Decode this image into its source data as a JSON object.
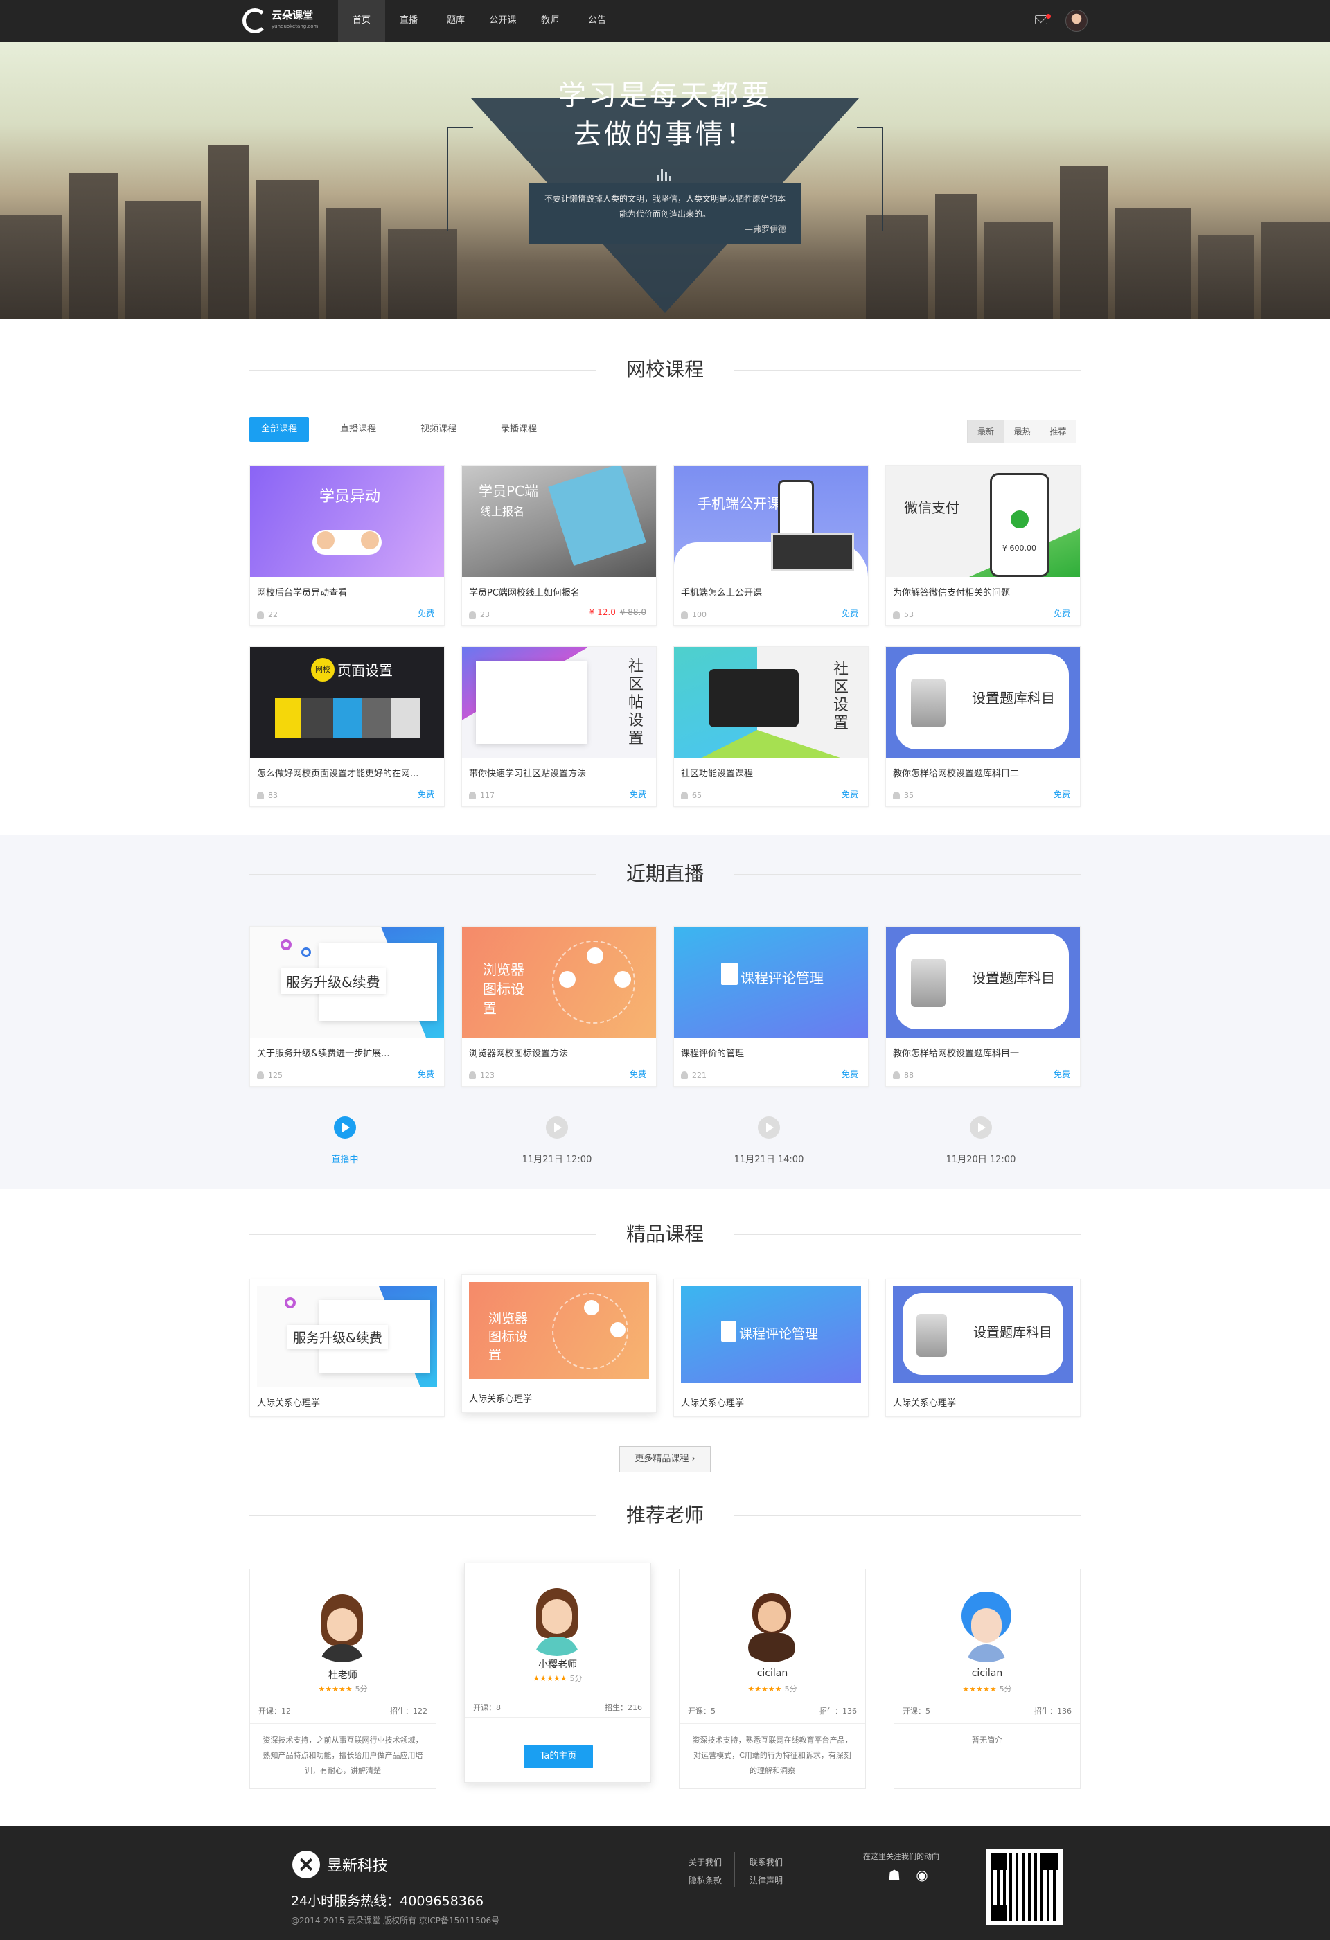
{
  "header": {
    "logo_text": "云朵课堂",
    "logo_sub": "yunduoketang.com",
    "nav": [
      "首页",
      "直播",
      "题库",
      "公开课",
      "教师",
      "公告"
    ]
  },
  "banner": {
    "title_line1": "学习是每天都要",
    "title_line2": "去做的事情！",
    "quote": "不要让懒惰毁掉人类的文明，我坚信，人类文明是以牺牲原始的本能为代价而创造出来的。",
    "author": "—弗罗伊德"
  },
  "online": {
    "title": "网校课程",
    "tabs": [
      "全部课程",
      "直播课程",
      "视频课程",
      "录播课程"
    ],
    "sort": [
      "最新",
      "最热",
      "推荐"
    ],
    "courses": [
      {
        "image_text": "学员异动",
        "title": "网校后台学员异动查看",
        "count": "22",
        "price": "免费"
      },
      {
        "image_text": "学员PC端线上报名",
        "title": "学员PC端网校线上如何报名",
        "count": "23",
        "price": "¥ 12.0",
        "old_price": "¥ 88.0"
      },
      {
        "image_text": "手机端公开课",
        "title": "手机端怎么上公开课",
        "count": "100",
        "price": "免费"
      },
      {
        "image_text": "微信支付",
        "title": "为你解答微信支付相关的问题",
        "count": "53",
        "price": "免费",
        "pay": "¥ 600.00"
      },
      {
        "image_text": "页面设置",
        "badge": "网校",
        "title": "怎么做好网校页面设置才能更好的在网...",
        "count": "83",
        "price": "免费"
      },
      {
        "image_text": "社区帖设置",
        "title": "带你快速学习社区贴设置方法",
        "count": "117",
        "price": "免费"
      },
      {
        "image_text": "社区设置",
        "title": "社区功能设置课程",
        "count": "65",
        "price": "免费"
      },
      {
        "image_text": "设置题库科目",
        "title": "教你怎样给网校设置题库科目二",
        "count": "35",
        "price": "免费"
      }
    ]
  },
  "live": {
    "title": "近期直播",
    "courses": [
      {
        "image_text": "服务升级&续费",
        "title": "关于服务升级&续费进一步扩展...",
        "count": "125",
        "price": "免费"
      },
      {
        "image_text": "浏览器图标设置",
        "title": "浏览器网校图标设置方法",
        "count": "123",
        "price": "免费"
      },
      {
        "image_text": "课程评论管理",
        "title": "课程评价的管理",
        "count": "221",
        "price": "免费"
      },
      {
        "image_text": "设置题库科目",
        "title": "教你怎样给网校设置题库科目一",
        "count": "88",
        "price": "免费"
      }
    ],
    "timeline": [
      "直播中",
      "11月21日 12:00",
      "11月21日 14:00",
      "11月20日 12:00"
    ]
  },
  "premium": {
    "title": "精品课程",
    "courses": [
      {
        "image_text": "服务升级&续费",
        "title": "人际关系心理学"
      },
      {
        "image_text": "浏览器图标设置",
        "title": "人际关系心理学"
      },
      {
        "image_text": "课程评论管理",
        "title": "人际关系心理学"
      },
      {
        "image_text": "设置题库科目",
        "title": "人际关系心理学"
      }
    ],
    "more": "更多精品课程"
  },
  "teachers": {
    "title": "推荐老师",
    "list": [
      {
        "name": "杜老师",
        "stars": "★★★★★",
        "score": "5分",
        "open": "开课：12",
        "students": "招生：122",
        "desc": "资深技术支持，之前从事互联网行业技术领域，熟知产品特点和功能，擅长给用户做产品应用培训，有耐心，讲解清楚"
      },
      {
        "name": "小樱老师",
        "stars": "★★★★★",
        "score": "5分",
        "open": "开课：8",
        "students": "招生：216",
        "button": "Ta的主页"
      },
      {
        "name": "cicilan",
        "stars": "★★★★★",
        "score": "5分",
        "open": "开课：5",
        "students": "招生：136",
        "desc": "资深技术支持，熟悉互联网在线教育平台产品，对运营模式，C用端的行为特征和诉求，有深刻的理解和洞察"
      },
      {
        "name": "cicilan",
        "stars": "★★★★★",
        "score": "5分",
        "open": "开课：5",
        "students": "招生：136",
        "desc": "暂无简介"
      }
    ]
  },
  "footer": {
    "brand": "昱新科技",
    "hotline": "24小时服务热线：4009658366",
    "copyright": "@2014-2015 云朵课堂    版权所有    京ICP备15011506号",
    "links": [
      "关于我们",
      "联系我们",
      "隐私条款",
      "法律声明"
    ],
    "follow": "在这里关注我们的动向"
  },
  "colors": {
    "accent": "#1a9ff2",
    "header": "#252525",
    "price_red": "#ff3333",
    "banner_overlay": "#2d404e"
  }
}
